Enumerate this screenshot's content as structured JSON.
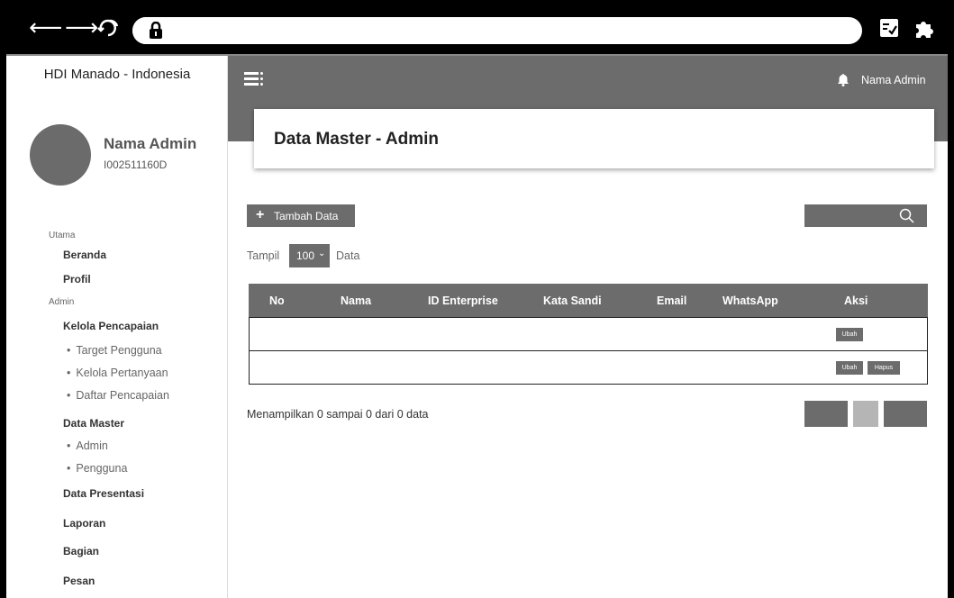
{
  "browser": {
    "back_icon": "arrow-left-icon",
    "forward_icon": "arrow-right-icon",
    "reload_icon": "reload-icon",
    "lock_icon": "lock-icon",
    "open_external_icon": "open-external-icon",
    "star_icon": "star-icon",
    "reader_icon": "reading-list-icon",
    "extensions_icon": "puzzle-icon"
  },
  "sidebar": {
    "brand": "HDI Manado - Indonesia",
    "user_name": "Nama Admin",
    "user_id": "I002511160D",
    "section_main": "Utama",
    "beranda": "Beranda",
    "profil": "Profil",
    "section_admin": "Admin",
    "kelola_pencapaian": "Kelola Pencapaian",
    "target_pengguna": "Target Pengguna",
    "kelola_pertanyaan": "Kelola Pertanyaan",
    "daftar_pencapaian": "Daftar Pencapaian",
    "data_master": "Data Master",
    "admin": "Admin",
    "pengguna": "Pengguna",
    "data_presentasi": "Data Presentasi",
    "laporan": "Laporan",
    "bagian": "Bagian",
    "pesan": "Pesan"
  },
  "header": {
    "admin_name": "Nama Admin",
    "page_title": "Data Master - Admin"
  },
  "toolbar": {
    "add_plus": "+",
    "add_label": "Tambah Data",
    "show_label": "Tampil",
    "show_value": "100",
    "show_chevron": "⌄",
    "data_label": "Data"
  },
  "table": {
    "columns": [
      "No",
      "Nama",
      "ID Enterprise",
      "Kata Sandi",
      "Email",
      "WhatsApp",
      "Aksi"
    ],
    "row1_edit": "Ubah",
    "row2_edit": "Ubah",
    "row2_delete": "Hapus"
  },
  "footer": {
    "info": "Menampilkan 0 sampai 0 dari 0 data"
  },
  "colors": {
    "accent_gray": "#6c6c6c",
    "light_gray": "#b5b5b5",
    "frame": "#000000"
  }
}
